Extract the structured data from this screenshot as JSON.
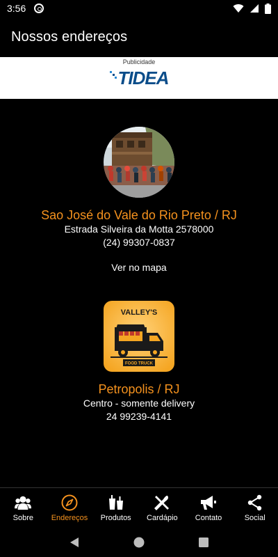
{
  "status_bar": {
    "time": "3:56"
  },
  "app_bar": {
    "title": "Nossos endereços"
  },
  "ad": {
    "label": "Publicidade",
    "brand": "TIDEA"
  },
  "locations": [
    {
      "city": "Sao José do Vale do Rio Preto / RJ",
      "address": "Estrada Silveira da Motta 2578000",
      "phone": "(24) 99307-0837",
      "map_link": "Ver no mapa"
    },
    {
      "city": "Petropolis / RJ",
      "address": "Centro - somente delivery",
      "phone": "24 99239-4141",
      "logo_text_top": "VALLEY'S",
      "logo_text_bottom": "FOOD TRUCK"
    }
  ],
  "bottom_nav": [
    {
      "label": "Sobre",
      "icon": "people-icon"
    },
    {
      "label": "Endereços",
      "icon": "compass-icon",
      "active": true
    },
    {
      "label": "Produtos",
      "icon": "drinks-icon"
    },
    {
      "label": "Cardápio",
      "icon": "utensils-icon"
    },
    {
      "label": "Contato",
      "icon": "megaphone-icon"
    },
    {
      "label": "Social",
      "icon": "share-icon"
    }
  ],
  "colors": {
    "accent": "#f5921e",
    "background": "#000000",
    "ad_brand": "#0b4d8a"
  }
}
